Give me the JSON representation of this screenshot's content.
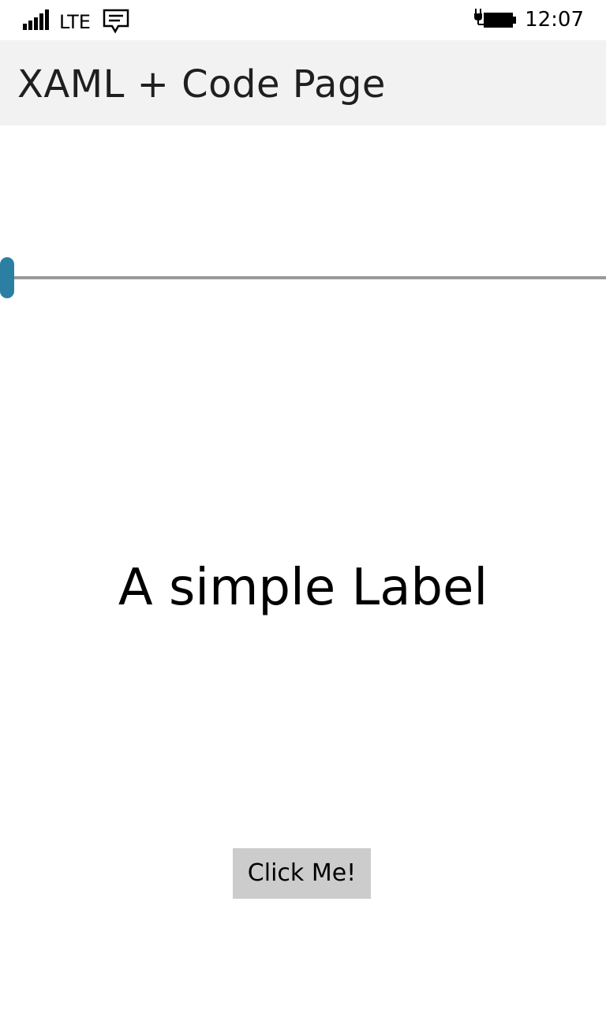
{
  "status_bar": {
    "network_type": "LTE",
    "time": "12:07",
    "signal_icon": "signal-bars-icon",
    "message_icon": "message-icon",
    "battery_icon": "battery-charging-icon"
  },
  "title_bar": {
    "title": "XAML + Code Page"
  },
  "slider": {
    "value": 0.0,
    "accent_color": "#2a7fa3",
    "track_color": "#9a9a9a"
  },
  "label": {
    "text": "A simple Label"
  },
  "button": {
    "label": "Click Me!",
    "background": "#cccccc"
  }
}
